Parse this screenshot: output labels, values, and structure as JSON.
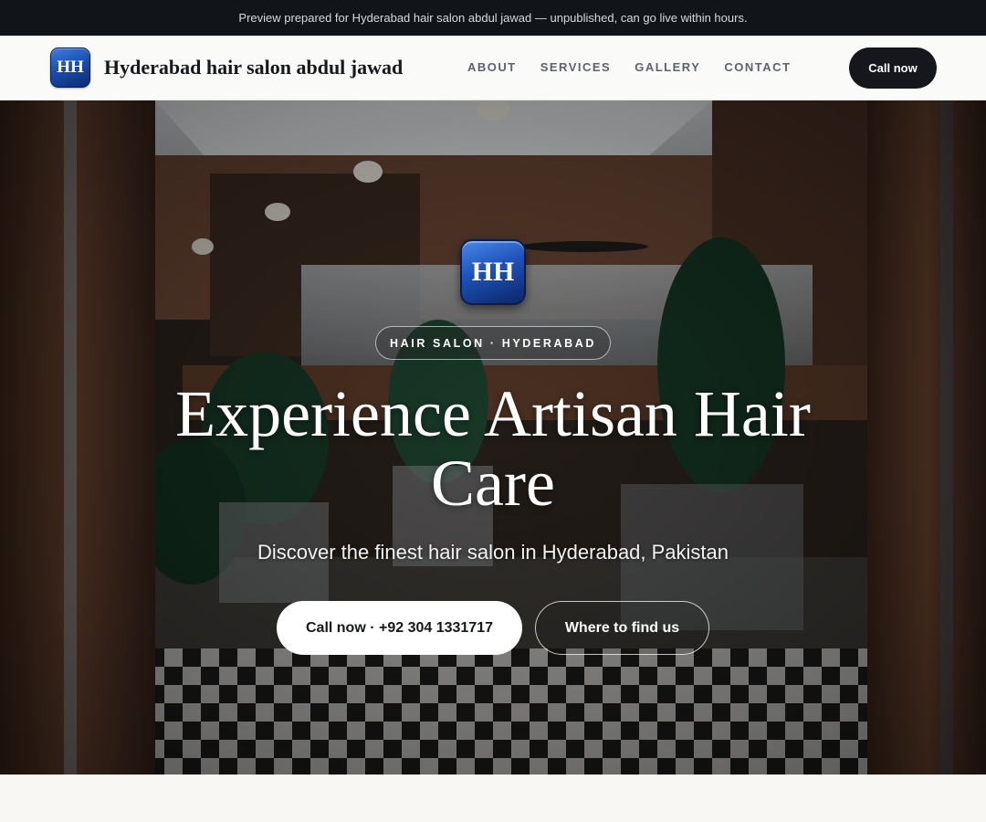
{
  "preview_bar": {
    "text": "Preview prepared for Hyderabad hair salon abdul jawad — unpublished, can go live within hours."
  },
  "header": {
    "logo_text": "HH",
    "brand_name": "Hyderabad hair salon abdul jawad",
    "nav": [
      {
        "label": "ABOUT"
      },
      {
        "label": "SERVICES"
      },
      {
        "label": "GALLERY"
      },
      {
        "label": "CONTACT"
      }
    ],
    "cta_label": "Call now"
  },
  "hero": {
    "logo_text": "HH",
    "tag": "HAIR SALON · HYDERABAD",
    "title": "Experience Artisan Hair Care",
    "subtitle": "Discover the finest hair salon in Hyderabad, Pakistan",
    "primary_button": "Call now · +92 304 1331717",
    "secondary_button": "Where to find us",
    "background_image": "barbershop-interior-photo"
  },
  "colors": {
    "dark": "#15171c",
    "preview_bar": "#111418",
    "logo_blue": "#1b4fb4",
    "nav_text": "#5b6272",
    "page_bg": "#f8f7f3"
  }
}
